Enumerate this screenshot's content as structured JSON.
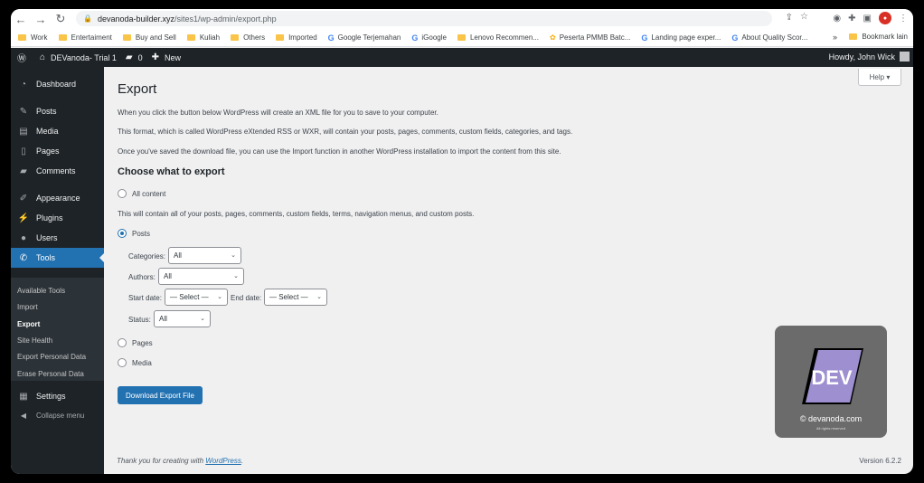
{
  "browser": {
    "url_host": "devanoda-builder.xyz",
    "url_path": "/sites1/wp-admin/export.php",
    "bookmarks": [
      {
        "label": "Work",
        "type": "folder"
      },
      {
        "label": "Entertaiment",
        "type": "folder"
      },
      {
        "label": "Buy and Sell",
        "type": "folder"
      },
      {
        "label": "Kuliah",
        "type": "folder"
      },
      {
        "label": "Others",
        "type": "folder"
      },
      {
        "label": "Imported",
        "type": "folder"
      },
      {
        "label": "Google Terjemahan",
        "type": "google"
      },
      {
        "label": "iGoogle",
        "type": "google"
      },
      {
        "label": "Lenovo Recommen...",
        "type": "folder"
      },
      {
        "label": "Peserta PMMB Batc...",
        "type": "flower"
      },
      {
        "label": "Landing page exper...",
        "type": "google"
      },
      {
        "label": "About Quality Scor...",
        "type": "google"
      }
    ],
    "bookmark_more": "»",
    "bookmark_other": "Bookmark lain"
  },
  "adminbar": {
    "site_name": "DEVanoda- Trial 1",
    "comments_count": "0",
    "new_label": "New",
    "howdy": "Howdy, John Wick"
  },
  "sidebar": {
    "items": [
      {
        "label": "Dashboard",
        "icon": "gauge-icon"
      },
      {
        "label": "Posts",
        "icon": "pin-icon"
      },
      {
        "label": "Media",
        "icon": "media-icon"
      },
      {
        "label": "Pages",
        "icon": "page-icon"
      },
      {
        "label": "Comments",
        "icon": "comment-icon"
      },
      {
        "label": "Appearance",
        "icon": "brush-icon"
      },
      {
        "label": "Plugins",
        "icon": "plugin-icon"
      },
      {
        "label": "Users",
        "icon": "user-icon"
      },
      {
        "label": "Tools",
        "icon": "wrench-icon"
      },
      {
        "label": "Settings",
        "icon": "settings-icon"
      }
    ],
    "submenu": [
      "Available Tools",
      "Import",
      "Export",
      "Site Health",
      "Export Personal Data",
      "Erase Personal Data"
    ],
    "collapse": "Collapse menu"
  },
  "main": {
    "help": "Help ▾",
    "title": "Export",
    "para1": "When you click the button below WordPress will create an XML file for you to save to your computer.",
    "para2": "This format, which is called WordPress eXtended RSS or WXR, will contain your posts, pages, comments, custom fields, categories, and tags.",
    "para3": "Once you've saved the download file, you can use the Import function in another WordPress installation to import the content from this site.",
    "choose_heading": "Choose what to export",
    "opt_all": "All content",
    "all_desc": "This will contain all of your posts, pages, comments, custom fields, terms, navigation menus, and custom posts.",
    "opt_posts": "Posts",
    "categories_label": "Categories:",
    "categories_value": "All",
    "authors_label": "Authors:",
    "authors_value": "All",
    "start_label": "Start date:",
    "start_value": "— Select —",
    "end_label": "End date:",
    "end_value": "— Select —",
    "status_label": "Status:",
    "status_value": "All",
    "opt_pages": "Pages",
    "opt_media": "Media",
    "download_btn": "Download Export File",
    "footer_text": "Thank you for creating with",
    "footer_link": "WordPress",
    "footer_period": ".",
    "version": "Version 6.2.2"
  },
  "watermark": {
    "logo_text": "DEV",
    "site": "© devanoda.com",
    "rights": "All rights reserved"
  }
}
